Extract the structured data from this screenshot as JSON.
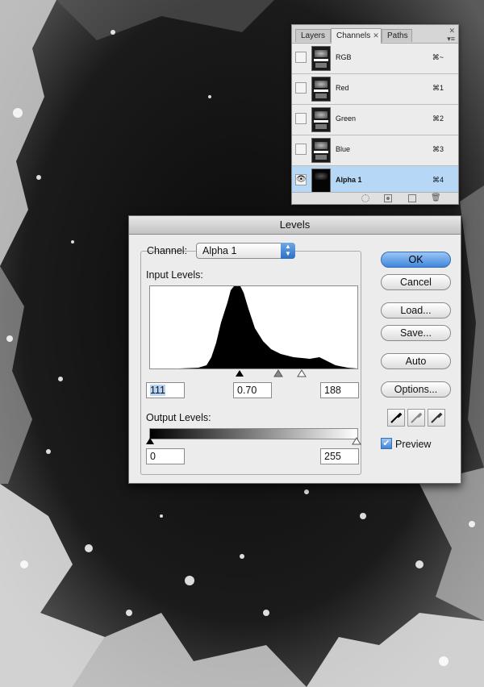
{
  "channels_panel": {
    "tabs": [
      {
        "label": "Layers"
      },
      {
        "label": "Channels",
        "close": "✕"
      },
      {
        "label": "Paths"
      }
    ],
    "rows": [
      {
        "label": "RGB",
        "shortcut": "⌘~"
      },
      {
        "label": "Red",
        "shortcut": "⌘1"
      },
      {
        "label": "Green",
        "shortcut": "⌘2"
      },
      {
        "label": "Blue",
        "shortcut": "⌘3"
      },
      {
        "label": "Alpha 1",
        "shortcut": "⌘4",
        "selected": true
      }
    ]
  },
  "levels_dialog": {
    "title": "Levels",
    "channel_label": "Channel:",
    "channel_value": "Alpha 1",
    "input_levels_label": "Input Levels:",
    "input_black": "111",
    "input_gamma": "0.70",
    "input_white": "188",
    "output_levels_label": "Output Levels:",
    "output_black": "0",
    "output_white": "255",
    "buttons": {
      "ok": "OK",
      "cancel": "Cancel",
      "load": "Load...",
      "save": "Save...",
      "auto": "Auto",
      "options": "Options..."
    },
    "preview_label": "Preview",
    "preview_checked": true
  },
  "colors": {
    "selection": "#b6d7f6",
    "default_button": "#3f86dc"
  }
}
